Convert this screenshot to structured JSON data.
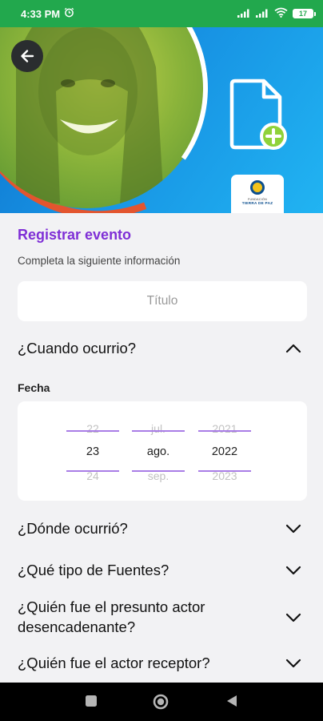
{
  "status_bar": {
    "time": "4:33 PM",
    "battery": "17"
  },
  "hero": {
    "logo_small": "FUNDACIÓN",
    "logo_name": "TIERRA DE PAZ"
  },
  "form": {
    "title": "Registrar evento",
    "subtitle": "Completa la siguiente información",
    "title_input": {
      "placeholder": "Título",
      "value": ""
    }
  },
  "sections": {
    "when": {
      "label": "¿Cuando ocurrio?",
      "expanded": true
    },
    "fecha_label": "Fecha",
    "where": {
      "label": "¿Dónde ocurrió?"
    },
    "sources": {
      "label": "¿Qué tipo de Fuentes?"
    },
    "trigger_actor": {
      "label": "¿Quién fue el presunto actor desencadenante?"
    },
    "receiver_actor": {
      "label": "¿Quién fue el actor receptor?"
    }
  },
  "date_picker": {
    "day": {
      "prev": "22",
      "selected": "23",
      "next": "24"
    },
    "month": {
      "prev": "jul.",
      "selected": "ago.",
      "next": "sep."
    },
    "year": {
      "prev": "2021",
      "selected": "2022",
      "next": "2023"
    }
  },
  "colors": {
    "accent": "#7f2fd6",
    "status_bar": "#22a84d",
    "hero_blue": "#1792e3",
    "plus_green": "#8fd23a"
  },
  "icons": {
    "back": "arrow-left-icon",
    "document_add": "document-plus-icon",
    "chevron_up": "chevron-up-icon",
    "chevron_down": "chevron-down-icon",
    "nav_recents": "square-icon",
    "nav_home": "circle-icon",
    "nav_back": "triangle-back-icon"
  }
}
